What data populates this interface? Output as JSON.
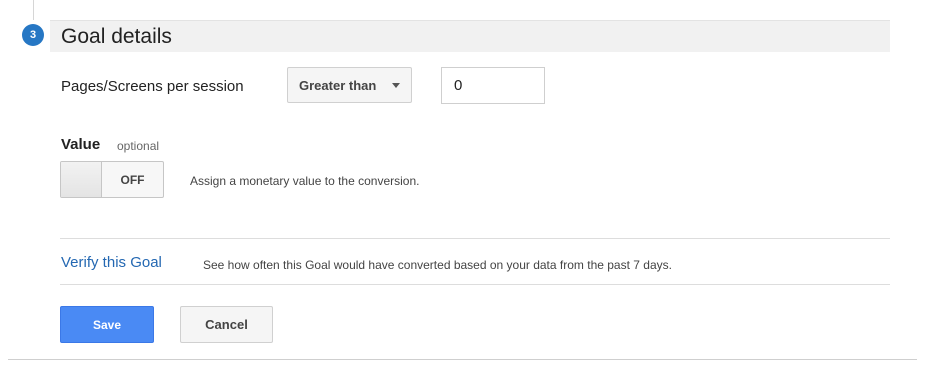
{
  "step": {
    "number": "3",
    "title": "Goal details"
  },
  "pages_condition": {
    "label": "Pages/Screens per session",
    "operator": "Greater than",
    "value": "0"
  },
  "value_section": {
    "label": "Value",
    "optional_label": "optional",
    "toggle_state": "OFF",
    "description": "Assign a monetary value to the conversion."
  },
  "verify": {
    "link_label": "Verify this Goal",
    "description": "See how often this Goal would have converted based on your data from the past 7 days."
  },
  "actions": {
    "save_label": "Save",
    "cancel_label": "Cancel"
  },
  "colors": {
    "accent": "#2677c4",
    "save_button": "#4a8af4",
    "link": "#2468b2"
  },
  "icons": {
    "dropdown": "caret-down-icon"
  }
}
